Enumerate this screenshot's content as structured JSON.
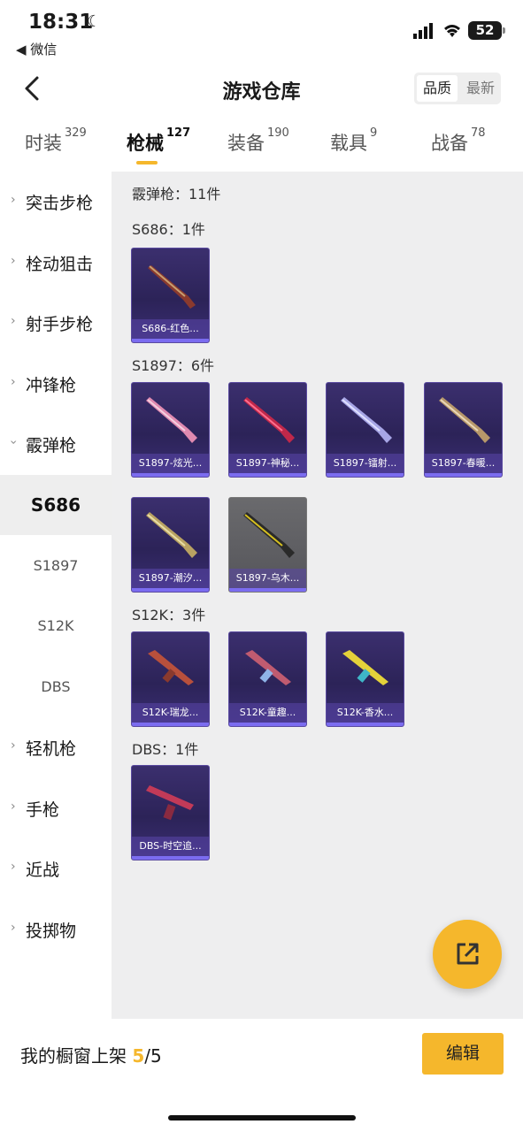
{
  "status": {
    "time": "18:31",
    "back_app": "◀ 微信",
    "battery": "52"
  },
  "header": {
    "title": "游戏仓库",
    "sort": [
      "品质",
      "最新"
    ]
  },
  "tabs": [
    {
      "label": "时装",
      "count": "329"
    },
    {
      "label": "枪械",
      "count": "127"
    },
    {
      "label": "装备",
      "count": "190"
    },
    {
      "label": "载具",
      "count": "9"
    },
    {
      "label": "战备",
      "count": "78"
    }
  ],
  "sidebar": {
    "categories": [
      "突击步枪",
      "栓动狙击",
      "射手步枪",
      "冲锋枪",
      "霰弹枪"
    ],
    "subs": [
      "S686",
      "S1897",
      "S12K",
      "DBS"
    ],
    "more": [
      "轻机枪",
      "手枪",
      "近战",
      "投掷物"
    ]
  },
  "main": {
    "summary": "霰弹枪：11件",
    "groups": [
      {
        "title": "S686：1件",
        "items": [
          "S686-红色..."
        ]
      },
      {
        "title": "S1897：6件",
        "items": [
          "S1897-炫光...",
          "S1897-神秘...",
          "S1897-镭射...",
          "S1897-春暖...",
          "S1897-潮汐...",
          "S1897-乌木..."
        ]
      },
      {
        "title": "S12K：3件",
        "items": [
          "S12K-瑞龙...",
          "S12K-童趣...",
          "S12K-香水..."
        ]
      },
      {
        "title": "DBS：1件",
        "items": [
          "DBS-时空追..."
        ]
      }
    ]
  },
  "bottom": {
    "shelf_label": "我的橱窗上架 ",
    "shelf_count": "5",
    "shelf_total": "/5",
    "edit": "编辑"
  },
  "colors": {
    "accent": "#f5b72c",
    "card_bg": "#2c2358"
  }
}
